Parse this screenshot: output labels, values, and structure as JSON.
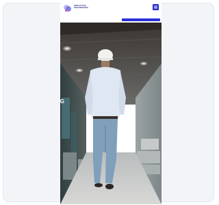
{
  "page": {
    "colors": {
      "background": "#ffffff",
      "card": "#f2f4f8",
      "brand": "#2a30d6",
      "menu_button": "#2830c9"
    }
  },
  "site": {
    "logo_text_line1": "INNOVATIVE",
    "logo_text_line2": "ENGINEERING",
    "logo_icon": "logo-mark-icon",
    "menu_icon": "hamburger-menu-icon",
    "cta_label": "",
    "side_fragment": "IG"
  },
  "hero": {
    "image_desc": "engineer in white hard hat walking through industrial warehouse"
  }
}
